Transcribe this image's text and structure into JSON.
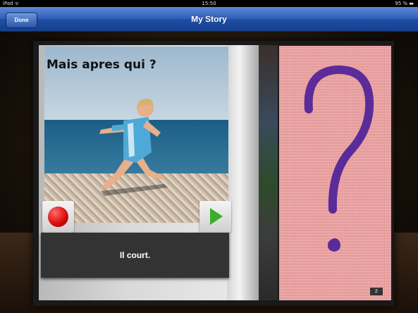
{
  "status_bar": {
    "carrier": "iPad ᯤ",
    "time": "15:50",
    "battery": "95 % ▬"
  },
  "nav": {
    "done_label": "Done",
    "title": "My Story"
  },
  "story_page": {
    "heading": "Mais apres qui ?",
    "caption": "Il court."
  },
  "right_page": {
    "page_number": "2",
    "background_color": "#eda1a1",
    "question_mark_color": "#5b2b9a"
  },
  "icons": {
    "record": "record-icon",
    "play": "play-icon",
    "question": "question-mark-icon"
  }
}
